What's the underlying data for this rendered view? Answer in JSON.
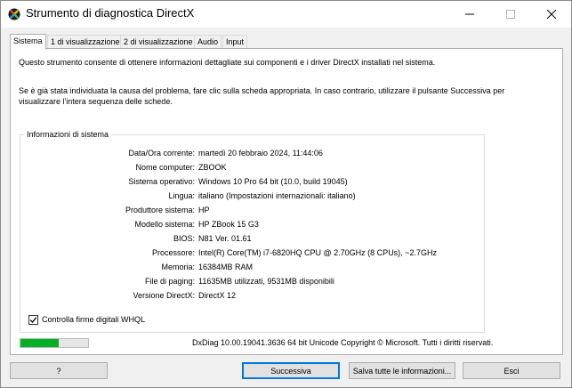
{
  "window": {
    "title": "Strumento di diagnostica DirectX",
    "icon": "directx-icon"
  },
  "tabs": [
    {
      "label": "Sistema",
      "active": true
    },
    {
      "label": "1 di visualizzazione",
      "active": false
    },
    {
      "label": "2 di visualizzazione",
      "active": false
    },
    {
      "label": "Audio",
      "active": false
    },
    {
      "label": "Input",
      "active": false
    }
  ],
  "intro": {
    "line1": "Questo strumento consente di ottenere informazioni dettagliate sui componenti e i driver DirectX installati nel sistema.",
    "line2": "Se è già stata individuata la causa del problema, fare clic sulla scheda appropriata. In caso contrario, utilizzare il pulsante Successiva per visualizzare l'intera sequenza delle schede."
  },
  "system_info": {
    "title": "Informazioni di sistema",
    "rows": [
      {
        "label": "Data/Ora corrente:",
        "value": "martedì 20 febbraio 2024, 11:44:06"
      },
      {
        "label": "Nome computer:",
        "value": "ZBOOK"
      },
      {
        "label": "Sistema operativo:",
        "value": "Windows 10 Pro 64 bit (10.0, build 19045)"
      },
      {
        "label": "Lingua:",
        "value": "italiano (Impostazioni internazionali: italiano)"
      },
      {
        "label": "Produttore sistema:",
        "value": "HP"
      },
      {
        "label": "Modello sistema:",
        "value": "HP ZBook 15 G3"
      },
      {
        "label": "BIOS:",
        "value": "N81 Ver. 01.61"
      },
      {
        "label": "Processore:",
        "value": "Intel(R) Core(TM) i7-6820HQ CPU @ 2.70GHz (8 CPUs), ~2.7GHz"
      },
      {
        "label": "Memoria:",
        "value": "16384MB RAM"
      },
      {
        "label": "File di paging:",
        "value": "11635MB utilizzati, 9531MB disponibili"
      },
      {
        "label": "Versione DirectX:",
        "value": "DirectX 12"
      }
    ]
  },
  "whql": {
    "label": "Controlla firme digitali WHQL",
    "checked": true
  },
  "progress": {
    "fraction": 0.57,
    "color": "#06b025"
  },
  "footer": {
    "version_text": "DxDiag 10.00.19041.3636 64 bit Unicode  Copyright © Microsoft. Tutti i diritti riservati."
  },
  "buttons": {
    "help": "?",
    "next": "Successiva",
    "save_all": "Salva tutte le informazioni...",
    "exit": "Esci"
  },
  "colors": {
    "accent": "#0078d7"
  }
}
